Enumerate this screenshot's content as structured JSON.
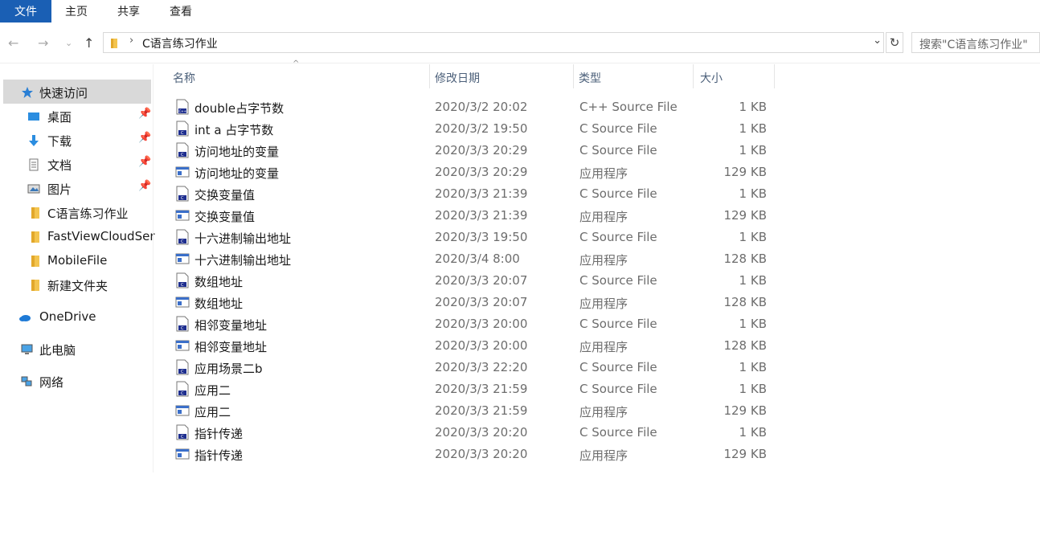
{
  "ribbon": {
    "tabs": [
      "文件",
      "主页",
      "共享",
      "查看"
    ]
  },
  "address": {
    "path": "C语言练习作业",
    "search_placeholder": "搜索\"C语言练习作业\""
  },
  "sidebar": {
    "items": [
      {
        "label": "快速访问",
        "icon": "star-icon",
        "pinned": false,
        "selected": true
      },
      {
        "label": "桌面",
        "icon": "desktop-icon",
        "pinned": true
      },
      {
        "label": "下载",
        "icon": "download-icon",
        "pinned": true
      },
      {
        "label": "文档",
        "icon": "document-icon",
        "pinned": true
      },
      {
        "label": "图片",
        "icon": "picture-icon",
        "pinned": true
      },
      {
        "label": "C语言练习作业",
        "icon": "folder-icon",
        "pinned": false
      },
      {
        "label": "FastViewCloudSer",
        "icon": "folder-icon",
        "pinned": false
      },
      {
        "label": "MobileFile",
        "icon": "folder-icon",
        "pinned": false
      },
      {
        "label": "新建文件夹",
        "icon": "folder-icon",
        "pinned": false
      },
      {
        "label": "OneDrive",
        "icon": "cloud-icon",
        "pinned": false
      },
      {
        "label": "此电脑",
        "icon": "computer-icon",
        "pinned": false
      },
      {
        "label": "网络",
        "icon": "network-icon",
        "pinned": false
      }
    ]
  },
  "columns": {
    "name": "名称",
    "date": "修改日期",
    "type": "类型",
    "size": "大小"
  },
  "files": [
    {
      "name": "double占字节数",
      "date": "2020/3/2 20:02",
      "type": "C++ Source File",
      "size": "1 KB",
      "icon": "cpp-file-icon"
    },
    {
      "name": "int a 占字节数",
      "date": "2020/3/2 19:50",
      "type": "C Source File",
      "size": "1 KB",
      "icon": "c-file-icon"
    },
    {
      "name": "访问地址的变量",
      "date": "2020/3/3 20:29",
      "type": "C Source File",
      "size": "1 KB",
      "icon": "c-file-icon"
    },
    {
      "name": "访问地址的变量",
      "date": "2020/3/3 20:29",
      "type": "应用程序",
      "size": "129 KB",
      "icon": "exe-icon"
    },
    {
      "name": "交换变量值",
      "date": "2020/3/3 21:39",
      "type": "C Source File",
      "size": "1 KB",
      "icon": "c-file-icon"
    },
    {
      "name": "交换变量值",
      "date": "2020/3/3 21:39",
      "type": "应用程序",
      "size": "129 KB",
      "icon": "exe-icon"
    },
    {
      "name": "十六进制输出地址",
      "date": "2020/3/3 19:50",
      "type": "C Source File",
      "size": "1 KB",
      "icon": "c-file-icon"
    },
    {
      "name": "十六进制输出地址",
      "date": "2020/3/4 8:00",
      "type": "应用程序",
      "size": "128 KB",
      "icon": "exe-icon"
    },
    {
      "name": "数组地址",
      "date": "2020/3/3 20:07",
      "type": "C Source File",
      "size": "1 KB",
      "icon": "c-file-icon"
    },
    {
      "name": "数组地址",
      "date": "2020/3/3 20:07",
      "type": "应用程序",
      "size": "128 KB",
      "icon": "exe-icon"
    },
    {
      "name": "相邻变量地址",
      "date": "2020/3/3 20:00",
      "type": "C Source File",
      "size": "1 KB",
      "icon": "c-file-icon"
    },
    {
      "name": "相邻变量地址",
      "date": "2020/3/3 20:00",
      "type": "应用程序",
      "size": "128 KB",
      "icon": "exe-icon"
    },
    {
      "name": "应用场景二b",
      "date": "2020/3/3 22:20",
      "type": "C Source File",
      "size": "1 KB",
      "icon": "c-file-icon"
    },
    {
      "name": "应用二",
      "date": "2020/3/3 21:59",
      "type": "C Source File",
      "size": "1 KB",
      "icon": "c-file-icon"
    },
    {
      "name": "应用二",
      "date": "2020/3/3 21:59",
      "type": "应用程序",
      "size": "129 KB",
      "icon": "exe-icon"
    },
    {
      "name": "指针传递",
      "date": "2020/3/3 20:20",
      "type": "C Source File",
      "size": "1 KB",
      "icon": "c-file-icon"
    },
    {
      "name": "指针传递",
      "date": "2020/3/3 20:20",
      "type": "应用程序",
      "size": "129 KB",
      "icon": "exe-icon"
    }
  ]
}
